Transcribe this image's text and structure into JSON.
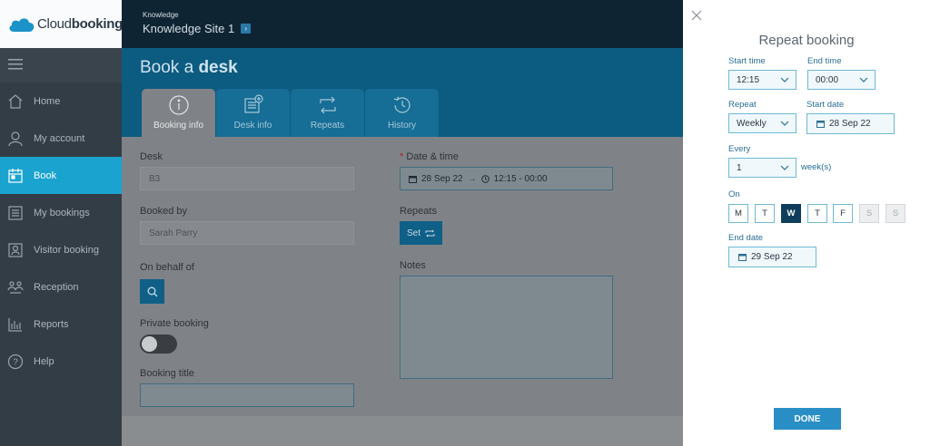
{
  "brand": {
    "logo_light": "Cloud",
    "logo_bold": "booking"
  },
  "sidebar": {
    "items": [
      {
        "label": "Home",
        "icon": "home-icon"
      },
      {
        "label": "My account",
        "icon": "user-icon"
      },
      {
        "label": "Book",
        "icon": "calendar-icon",
        "active": true
      },
      {
        "label": "My bookings",
        "icon": "list-icon"
      },
      {
        "label": "Visitor booking",
        "icon": "visitor-icon"
      },
      {
        "label": "Reception",
        "icon": "reception-icon"
      },
      {
        "label": "Reports",
        "icon": "bar-chart-icon"
      },
      {
        "label": "Help",
        "icon": "help-icon"
      }
    ]
  },
  "header": {
    "sub": "Knowledge",
    "site": "Knowledge Site 1"
  },
  "page": {
    "title_light": "Book a",
    "title_bold": "desk"
  },
  "tabs": [
    {
      "label": "Booking info",
      "icon": "info-icon",
      "active": true
    },
    {
      "label": "Desk info",
      "icon": "desk-info-icon"
    },
    {
      "label": "Repeats",
      "icon": "repeat-icon"
    },
    {
      "label": "History",
      "icon": "history-icon"
    }
  ],
  "form": {
    "desk_label": "Desk",
    "desk_value": "B3",
    "booked_by_label": "Booked by",
    "booked_by_value": "Sarah Parry",
    "on_behalf_label": "On behalf of",
    "private_label": "Private booking",
    "title_label": "Booking title",
    "datetime_label": "Date & time",
    "datetime_required": "*",
    "datetime_date": "28 Sep 22",
    "datetime_time": "12:15 - 00:00",
    "repeats_label": "Repeats",
    "set_label": "Set",
    "notes_label": "Notes"
  },
  "repeat_panel": {
    "title": "Repeat booking",
    "start_time_label": "Start time",
    "start_time_value": "12:15",
    "end_time_label": "End time",
    "end_time_value": "00:00",
    "repeat_label": "Repeat",
    "repeat_value": "Weekly",
    "start_date_label": "Start date",
    "start_date_value": "28 Sep 22",
    "every_label": "Every",
    "every_value": "1",
    "every_unit": "week(s)",
    "on_label": "On",
    "days": [
      {
        "label": "M",
        "state": "normal"
      },
      {
        "label": "T",
        "state": "normal"
      },
      {
        "label": "W",
        "state": "selected"
      },
      {
        "label": "T",
        "state": "normal"
      },
      {
        "label": "F",
        "state": "normal"
      },
      {
        "label": "S",
        "state": "disabled"
      },
      {
        "label": "S",
        "state": "disabled"
      }
    ],
    "end_date_label": "End date",
    "end_date_value": "29 Sep 22",
    "done_label": "DONE"
  },
  "colors": {
    "accent": "#1aa3cf",
    "header_dark": "#0f2433",
    "banner_blue": "#0c5b80",
    "done_button": "#2a8ec6",
    "day_selected": "#0f3e5c"
  }
}
